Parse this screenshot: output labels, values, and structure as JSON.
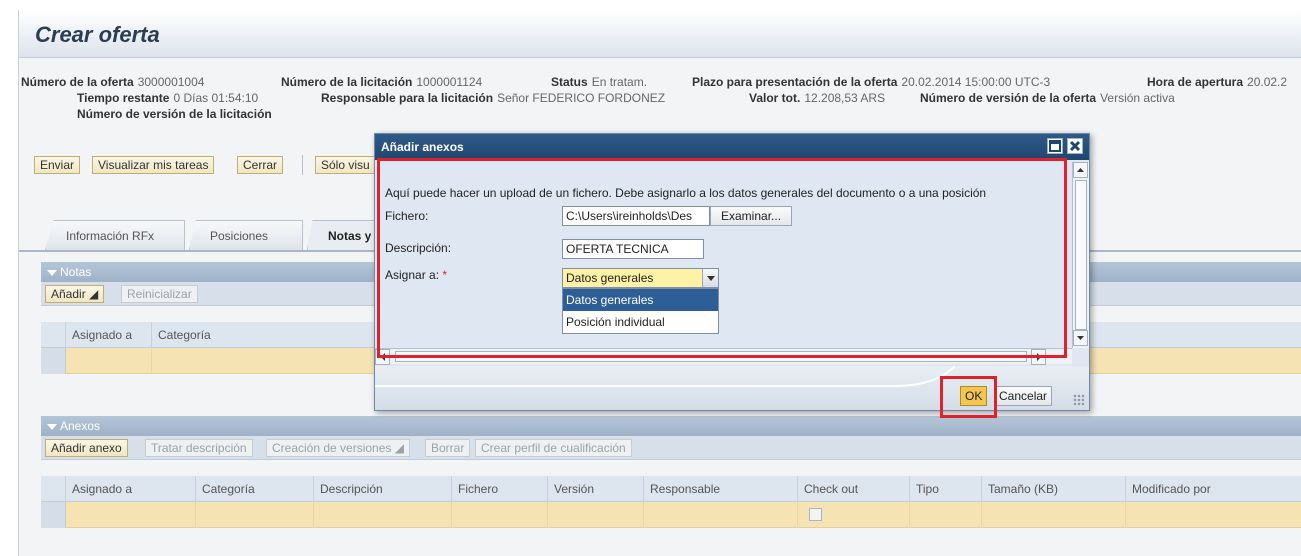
{
  "page": {
    "title": "Crear oferta"
  },
  "header": {
    "fields": [
      {
        "label": "Número de la oferta",
        "value": "3000001004"
      },
      {
        "label": "Número de la licitación",
        "value": "1000001124"
      },
      {
        "label": "Status",
        "value": "En tratam."
      },
      {
        "label": "Plazo para presentación de la oferta",
        "value": "20.02.2014 15:00:00 UTC-3"
      },
      {
        "label": "Hora de apertura",
        "value": "20.02.2"
      },
      {
        "label": "Tiempo restante",
        "value": "0 Días 01:54:10"
      },
      {
        "label": "Responsable para la licitación",
        "value": "Señor FEDERICO FORDONEZ"
      },
      {
        "label": "Valor tot.",
        "value": "12.208,53 ARS"
      },
      {
        "label": "Número de versión de la oferta",
        "value": "Versión activa"
      },
      {
        "label": "Número de versión de la licitación",
        "value": ""
      }
    ]
  },
  "toolbar": {
    "enviar": "Enviar",
    "mis_tareas": "Visualizar mis tareas",
    "cerrar": "Cerrar",
    "solo_visu": "Sólo visu"
  },
  "tabs": [
    {
      "label": "Información RFx"
    },
    {
      "label": "Posiciones"
    },
    {
      "label": "Notas y"
    }
  ],
  "notas": {
    "title": "Notas",
    "buttons": {
      "anadir": "Añadir",
      "reinicializar": "Reinicializar"
    },
    "columns": [
      "Asignado a",
      "Categoría"
    ]
  },
  "anexos": {
    "title": "Anexos",
    "buttons": {
      "anadir_anexo": "Añadir anexo",
      "tratar": "Tratar descripción",
      "versiones": "Creación de versiones",
      "borrar": "Borrar",
      "perfil": "Crear perfil de cualificación"
    },
    "columns": [
      "Asignado a",
      "Categoría",
      "Descripción",
      "Fichero",
      "Versión",
      "Responsable",
      "Check out",
      "Tipo",
      "Tamaño (KB)",
      "Modificado por"
    ]
  },
  "dialog": {
    "title": "Añadir anexos",
    "intro": "Aquí puede hacer un upload de un fichero. Debe asignarlo a los datos generales del documento o a una posición",
    "fichero_label": "Fichero:",
    "fichero_value": "C:\\Users\\ireinholds\\Des",
    "examinar": "Examinar...",
    "descripcion_label": "Descripción:",
    "descripcion_value": "OFERTA TECNICA",
    "asignar_label": "Asignar a:",
    "required_mark": "*",
    "asignar_value": "Datos generales",
    "options": [
      "Datos generales",
      "Posición individual"
    ],
    "ok": "OK",
    "cancelar": "Cancelar"
  },
  "colors": {
    "highlight": "#e0202a",
    "ok": "#f4c64f",
    "title_bar": "#1f4670"
  }
}
